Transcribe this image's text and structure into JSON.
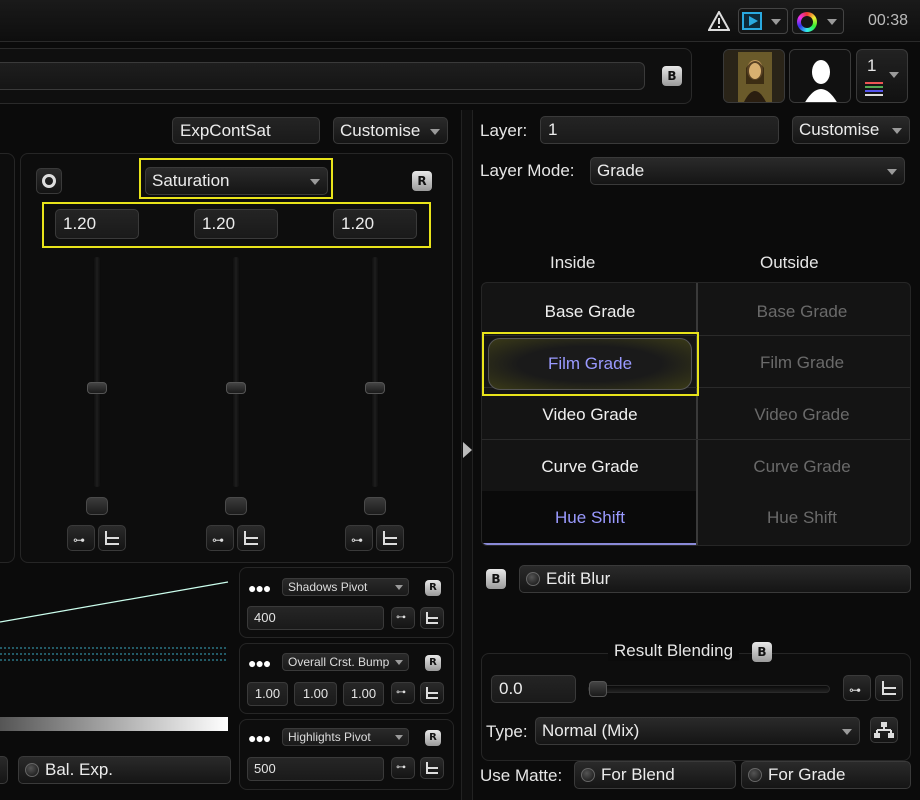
{
  "topbar": {
    "time": "00:38"
  },
  "header": {
    "b_badge": "B",
    "layer_stack_number": "1"
  },
  "left": {
    "preset_value": "ExpContSat",
    "customise_label": "Customise",
    "mode_dropdown": "Saturation",
    "r_badge": "R",
    "values": [
      "1.20",
      "1.20",
      "1.20"
    ]
  },
  "pivots": [
    {
      "label": "Shadows Pivot",
      "values": [
        "400"
      ]
    },
    {
      "label": "Overall Crst. Bump",
      "values": [
        "1.00",
        "1.00",
        "1.00"
      ]
    },
    {
      "label": "Highlights Pivot",
      "values": [
        "500"
      ]
    }
  ],
  "pivot_r_badge": "R",
  "bottom_left": {
    "bal_exp_label": "Bal. Exp."
  },
  "right": {
    "layer_label": "Layer:",
    "layer_value": "1",
    "customise_label": "Customise",
    "layer_mode_label": "Layer Mode:",
    "layer_mode_value": "Grade",
    "inside_label": "Inside",
    "outside_label": "Outside",
    "inside_grades": [
      "Base Grade",
      "Film Grade",
      "Video Grade",
      "Curve Grade",
      "Hue Shift"
    ],
    "outside_grades": [
      "Base Grade",
      "Film Grade",
      "Video Grade",
      "Curve Grade",
      "Hue Shift"
    ],
    "blur_badge": "B",
    "edit_blur_label": "Edit Blur",
    "result_blending_label": "Result Blending",
    "result_b_badge": "B",
    "blend_value": "0.0",
    "type_label": "Type:",
    "type_value": "Normal (Mix)",
    "use_matte_label": "Use Matte:",
    "for_blend_label": "For Blend",
    "for_grade_label": "For Grade"
  },
  "colors": {
    "highlight": "#e8e31a",
    "selected_text": "#9a9aff",
    "disabled_text": "#6a6a6a"
  }
}
